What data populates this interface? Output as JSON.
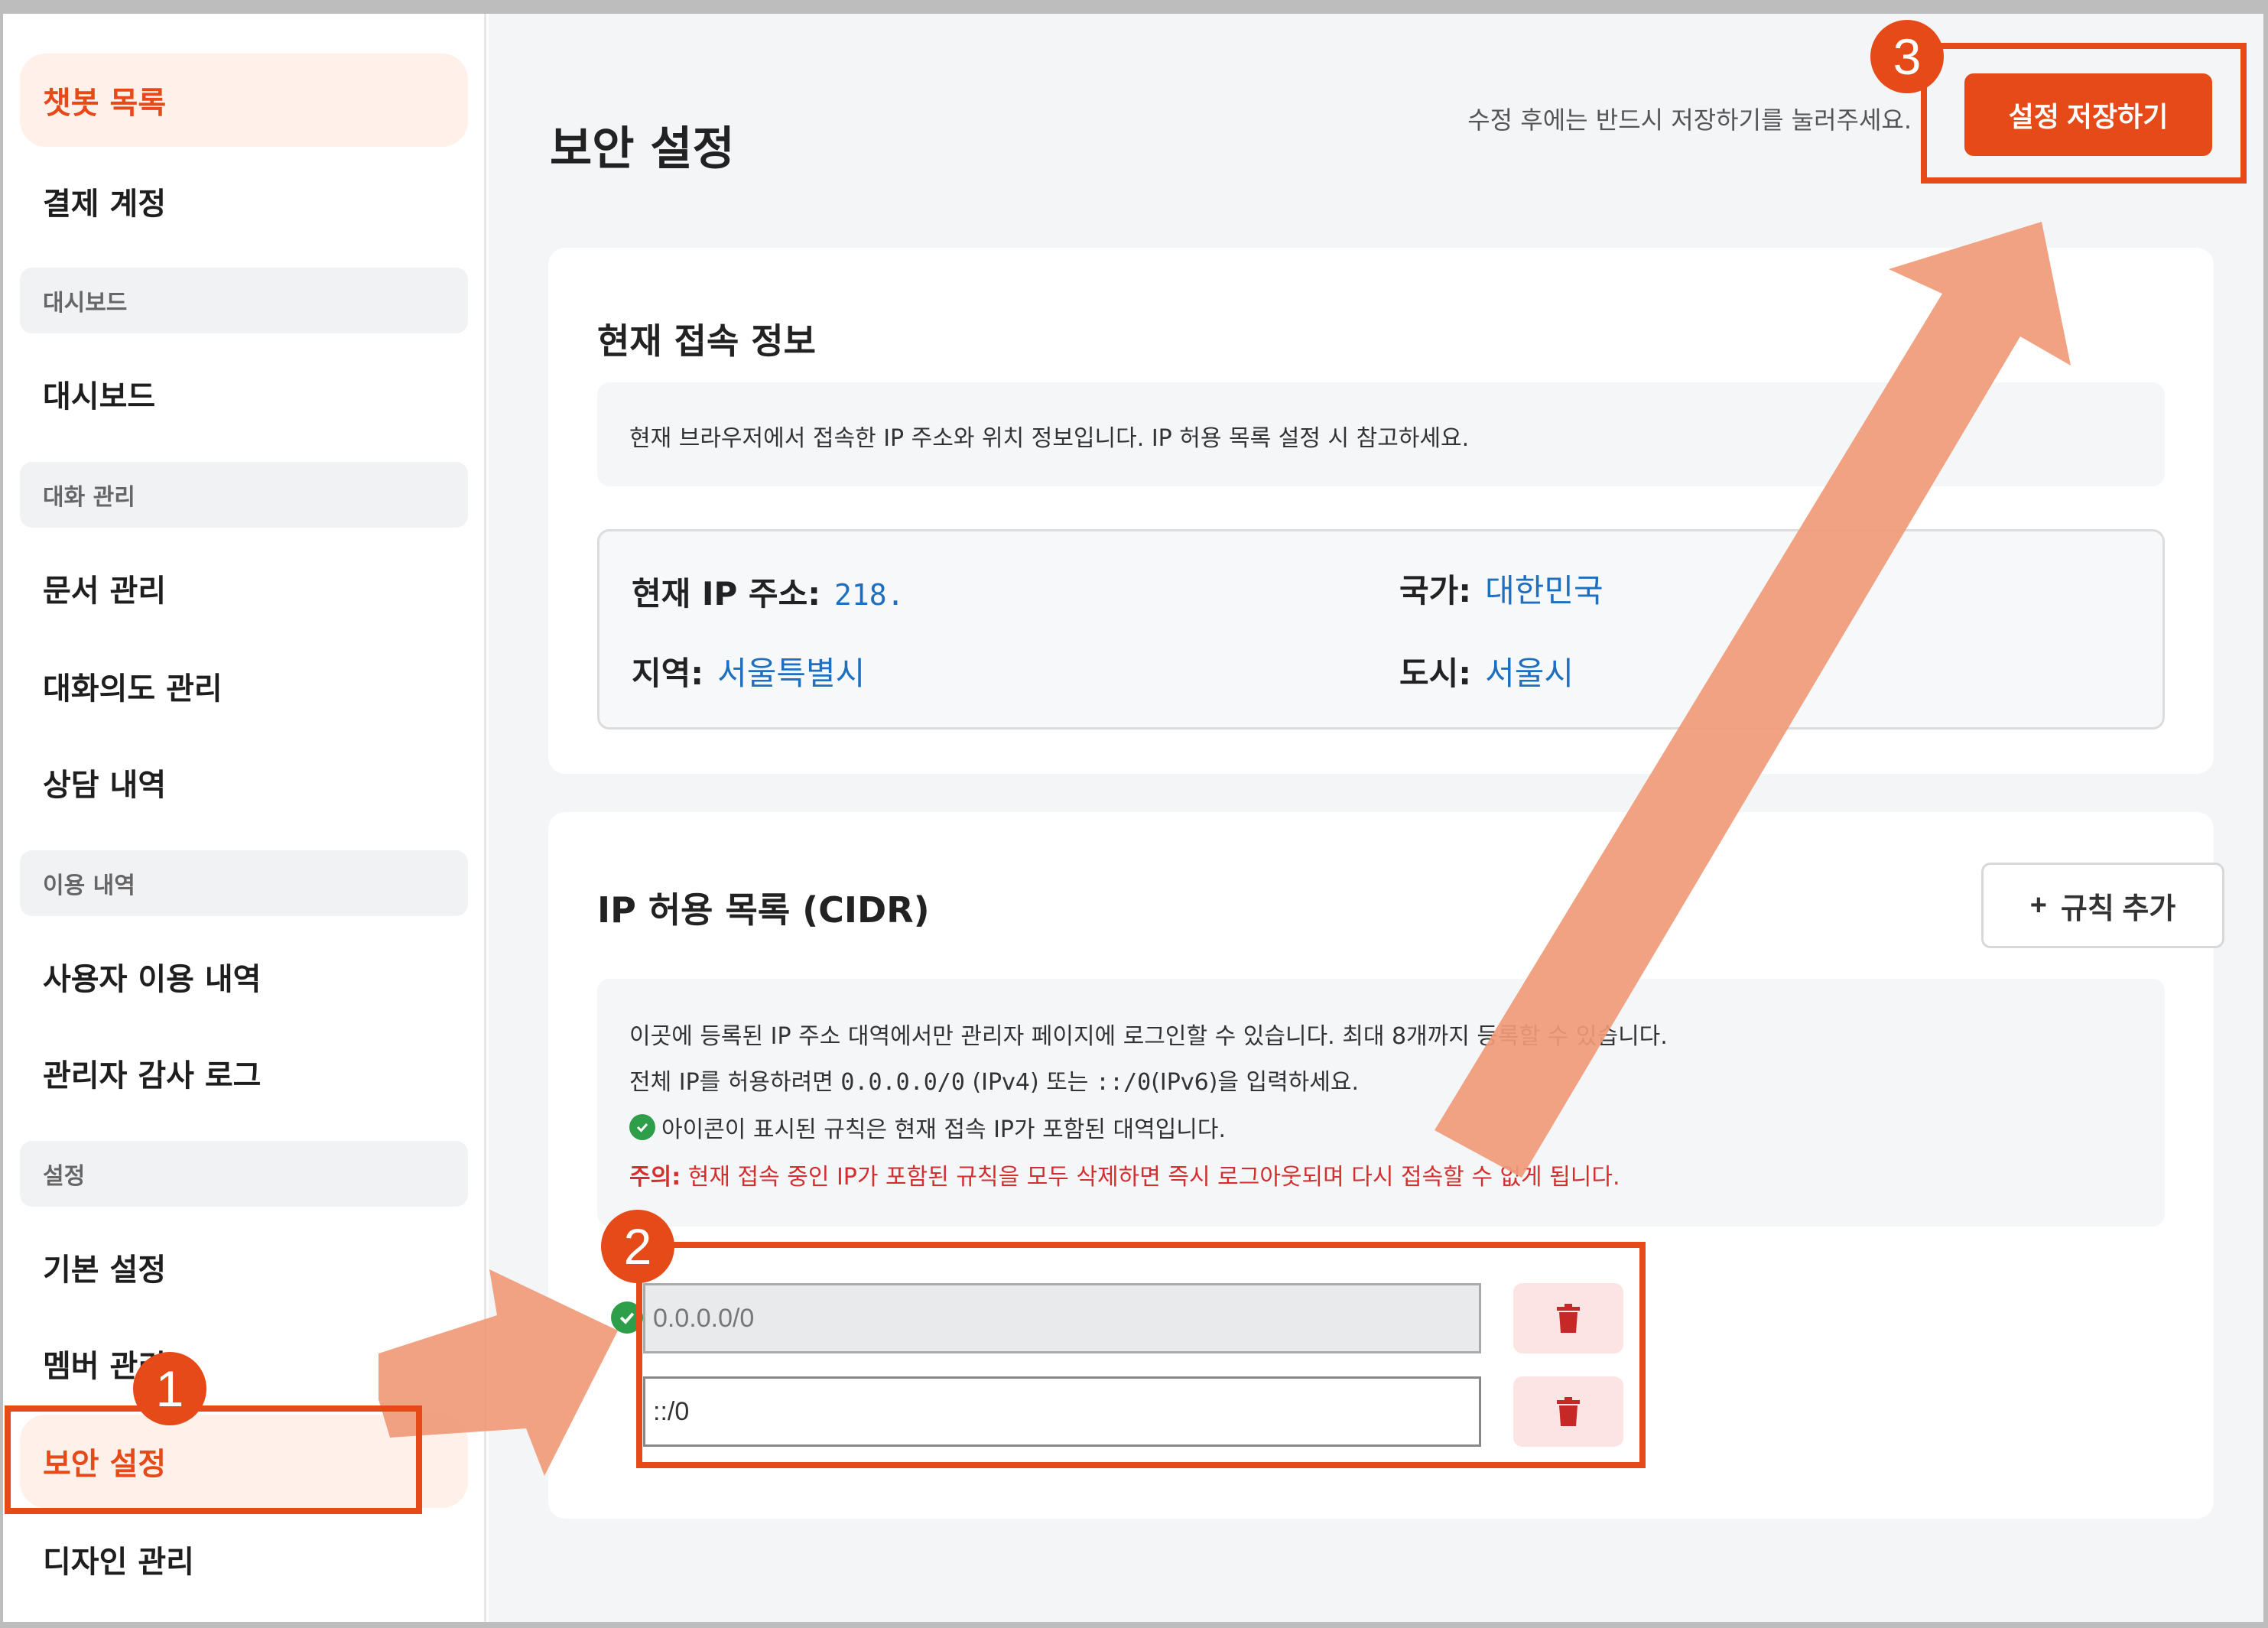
{
  "sidebar": {
    "items": [
      {
        "label": "챗봇 목록",
        "active": true
      },
      {
        "label": "결제 계정"
      },
      {
        "section": "대시보드"
      },
      {
        "label": "대시보드"
      },
      {
        "section": "대화 관리"
      },
      {
        "label": "문서 관리"
      },
      {
        "label": "대화의도 관리"
      },
      {
        "label": "상담 내역"
      },
      {
        "section": "이용 내역"
      },
      {
        "label": "사용자 이용 내역"
      },
      {
        "label": "관리자 감사 로그"
      },
      {
        "section": "설정"
      },
      {
        "label": "기본 설정"
      },
      {
        "label": "멤버 관리"
      },
      {
        "label": "보안 설정",
        "active": true
      },
      {
        "label": "디자인 관리"
      }
    ]
  },
  "header": {
    "title": "보안 설정",
    "save_hint": "수정 후에는 반드시 저장하기를 눌러주세요.",
    "save_label": "설정 저장하기"
  },
  "current": {
    "title": "현재 접속 정보",
    "desc": "현재 브라우저에서 접속한 IP 주소와 위치 정보입니다. IP 허용 목록 설정 시 참고하세요.",
    "ip_label": "현재 IP 주소:",
    "ip_value": "218.",
    "country_label": "국가:",
    "country_value": "대한민국",
    "region_label": "지역:",
    "region_value": "서울특별시",
    "city_label": "도시:",
    "city_value": "서울시"
  },
  "allowlist": {
    "title": "IP 허용 목록 (CIDR)",
    "add_plus": "+",
    "add_label": "규칙 추가",
    "line1": "이곳에 등록된 IP 주소 대역에서만 관리자 페이지에 로그인할 수 있습니다. 최대 8개까지 등록할 수 있습니다.",
    "line2_prefix": "전체 IP를 허용하려면",
    "line2_v4": "0.0.0.0/0",
    "line2_mid": "(IPv4) 또는",
    "line2_v6": "::/0",
    "line2_suffix": "(IPv6)을 입력하세요.",
    "line3": "아이콘이 표시된 규칙은 현재 접속 IP가 포함된 대역입니다.",
    "warn_label": "주의:",
    "warn_text": "현재 접속 중인 IP가 포함된 규칙을 모두 삭제하면 즉시 로그아웃되며 다시 접속할 수 없게 됩니다.",
    "rules": [
      {
        "value": "0.0.0.0/0",
        "current": true,
        "disabled": true
      },
      {
        "value": "::/0",
        "current": false,
        "disabled": false
      }
    ]
  },
  "annotations": {
    "badge1": "1",
    "badge2": "2",
    "badge3": "3"
  },
  "colors": {
    "accent": "#e64a19",
    "link": "#1e6fbf",
    "arrow": "#ef9a78"
  }
}
